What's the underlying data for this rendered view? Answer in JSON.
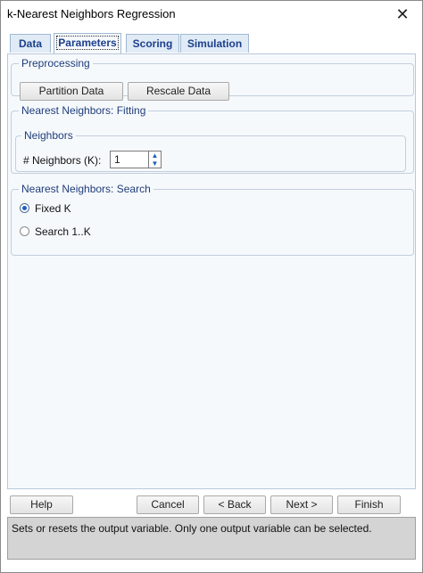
{
  "window": {
    "title": "k-Nearest Neighbors Regression",
    "close_glyph": "✕"
  },
  "tabs": [
    {
      "label": "Data",
      "active": false
    },
    {
      "label": "Parameters",
      "active": true
    },
    {
      "label": "Scoring",
      "active": false
    },
    {
      "label": "Simulation",
      "active": false
    }
  ],
  "preprocessing": {
    "legend": "Preprocessing",
    "partition_label": "Partition Data",
    "rescale_label": "Rescale Data"
  },
  "fitting": {
    "legend": "Nearest Neighbors: Fitting",
    "neighbors_legend": "Neighbors",
    "k_label": "# Neighbors (K):",
    "k_value": "1"
  },
  "search": {
    "legend": "Nearest Neighbors: Search",
    "options": [
      {
        "label": "Fixed K",
        "checked": true
      },
      {
        "label": "Search 1..K",
        "checked": false
      }
    ]
  },
  "footer": {
    "help": "Help",
    "cancel": "Cancel",
    "back": "< Back",
    "next": "Next >",
    "finish": "Finish"
  },
  "status": {
    "text": "Sets or resets the output variable. Only one output variable can be selected."
  }
}
